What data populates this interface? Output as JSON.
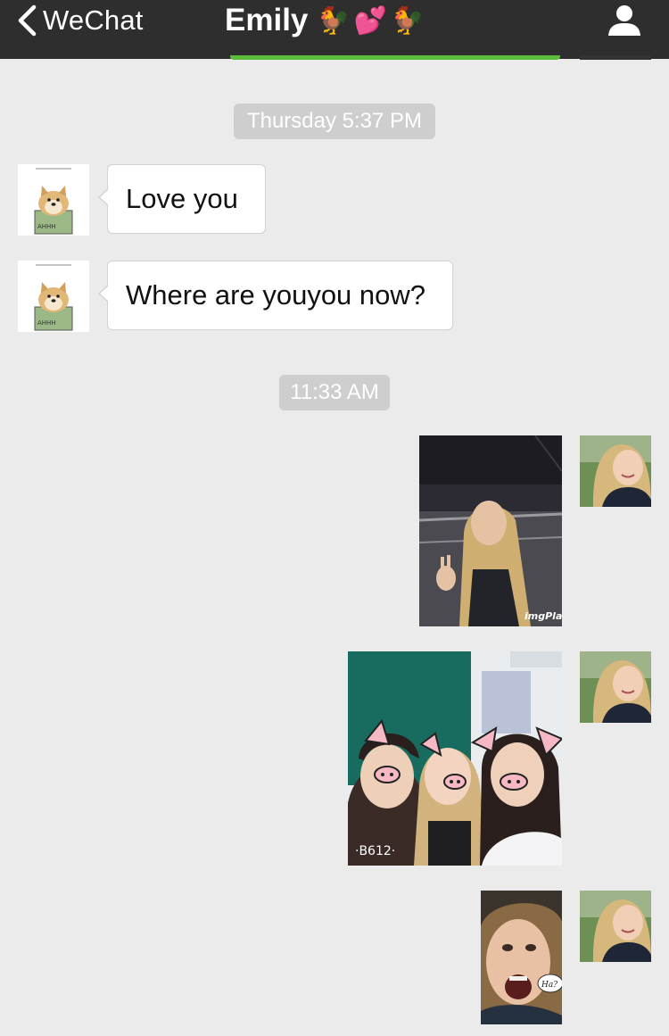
{
  "header": {
    "back_label": "WeChat",
    "title": "Emily",
    "title_emoji": "🐓💕🐓",
    "back_icon": "chevron-left-icon",
    "profile_icon": "person-icon"
  },
  "colors": {
    "header_bg": "#2e2e2e",
    "chat_bg": "#ebebeb",
    "bubble_bg": "#ffffff",
    "timestamp_bg": "#cecece",
    "accent_green": "#5bbd3a"
  },
  "messages": {
    "timestamp_1": "Thursday 5:37 PM",
    "incoming_1": "Love you",
    "incoming_2": "Where are youyou now?",
    "timestamp_2": "11:33 AM",
    "image_1_watermark": "imgPlay",
    "image_2_caption": "·B612·",
    "image_3_caption": "Ha?",
    "doge_sticker_text": "AHHH"
  }
}
